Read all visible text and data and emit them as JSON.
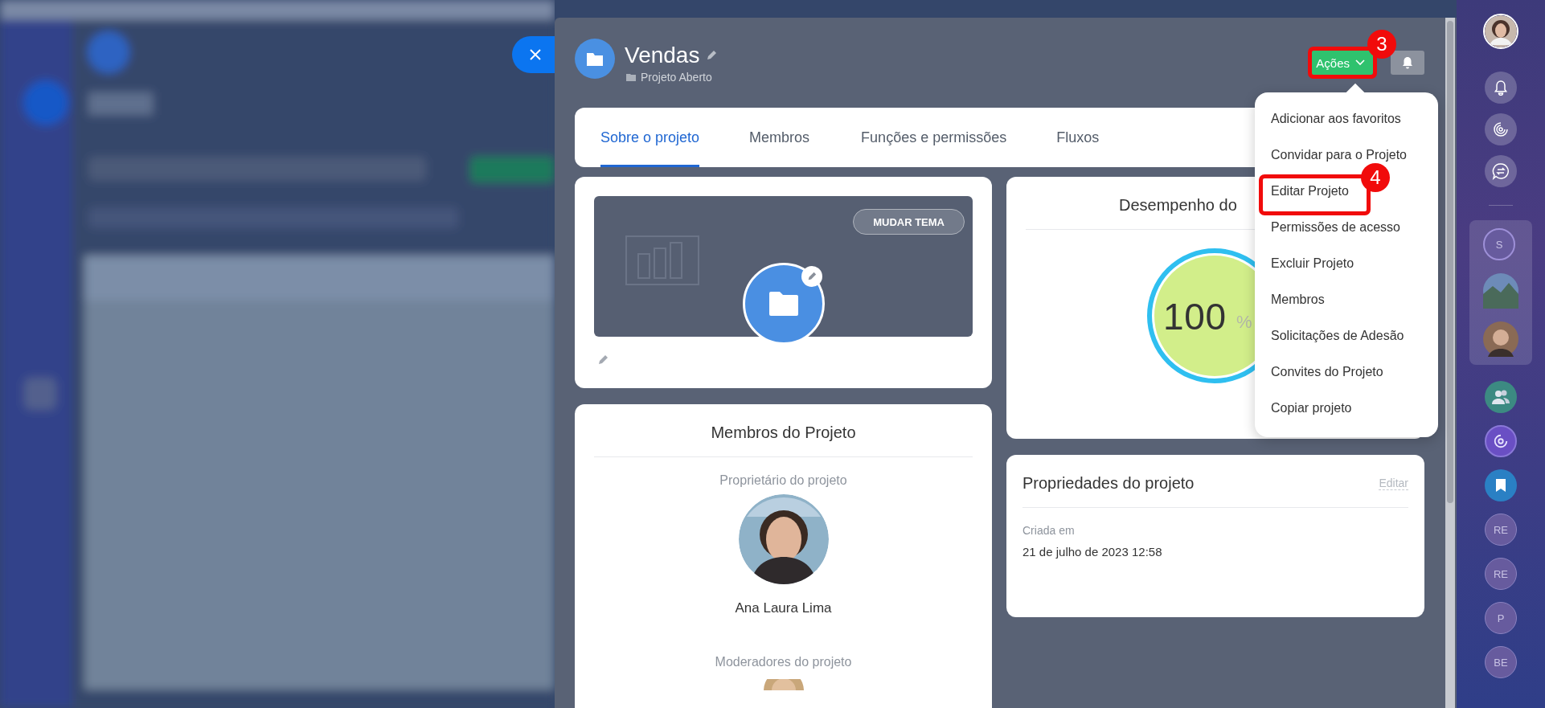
{
  "project": {
    "title": "Vendas",
    "subtitle": "Projeto Aberto"
  },
  "actions_button": {
    "label": "Ações",
    "annotation": "3"
  },
  "tabs": [
    {
      "label": "Sobre o projeto",
      "selected": true
    },
    {
      "label": "Membros",
      "selected": false
    },
    {
      "label": "Funções e permissões",
      "selected": false
    },
    {
      "label": "Fluxos",
      "selected": false
    }
  ],
  "theme_card": {
    "button": "MUDAR TEMA"
  },
  "members_card": {
    "title": "Membros do Projeto",
    "owner_label": "Proprietário do projeto",
    "owner_name": "Ana Laura Lima",
    "moderators_label": "Moderadores do projeto"
  },
  "performance_card": {
    "title": "Desempenho do",
    "value": "100",
    "unit": "%",
    "level": 1
  },
  "properties_card": {
    "title": "Propriedades do projeto",
    "edit_link": "Editar",
    "fields": [
      {
        "label": "Criada em",
        "value": "21 de julho de 2023 12:58"
      }
    ]
  },
  "actions_menu": {
    "items": [
      {
        "label": "Adicionar aos favoritos"
      },
      {
        "label": "Convidar para o Projeto"
      },
      {
        "label": "Editar Projeto",
        "annotation": "4"
      },
      {
        "label": "Permissões de acesso"
      },
      {
        "label": "Excluir Projeto"
      },
      {
        "label": "Membros"
      },
      {
        "label": "Solicitações de Adesão"
      },
      {
        "label": "Convites do Projeto"
      },
      {
        "label": "Copiar projeto"
      }
    ]
  },
  "recent_chats": [
    {
      "kind": "initials",
      "initials": "S"
    },
    {
      "kind": "picture"
    },
    {
      "kind": "picture"
    }
  ],
  "chats": [
    {
      "kind": "group"
    },
    {
      "kind": "channel"
    },
    {
      "kind": "bookmark"
    },
    {
      "kind": "initials",
      "initials": "RE"
    },
    {
      "kind": "initials",
      "initials": "RE"
    },
    {
      "kind": "initials",
      "initials": "P"
    },
    {
      "kind": "initials",
      "initials": "BE"
    }
  ]
}
